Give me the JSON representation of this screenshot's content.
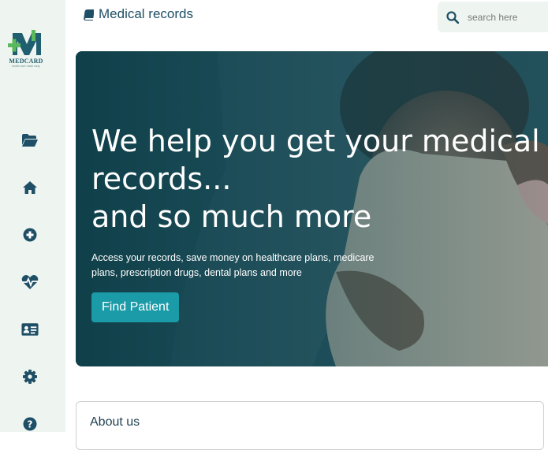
{
  "app": {
    "logo_text": "MEDCARD",
    "logo_tagline": "health care made easy",
    "brand_color": "#1f5f6f",
    "accent_color": "#1b9aa8",
    "logo_green": "#5cb85c"
  },
  "sidebar": {
    "items": [
      {
        "icon": "folder-open-icon"
      },
      {
        "icon": "home-icon"
      },
      {
        "icon": "plus-circle-icon"
      },
      {
        "icon": "heart-pulse-icon"
      },
      {
        "icon": "id-card-icon"
      },
      {
        "icon": "gear-icon"
      },
      {
        "icon": "question-circle-icon"
      }
    ]
  },
  "header": {
    "title": "Medical records",
    "title_icon": "book-icon"
  },
  "search": {
    "placeholder": "search here",
    "icon": "search-icon"
  },
  "hero": {
    "headline_line1": "We help you get your medical",
    "headline_line2": "records...",
    "headline_line3": "and so much more",
    "description": "Access your records, save money on healthcare plans, medicare plans, prescription drugs, dental plans and more",
    "button_label": "Find Patient"
  },
  "about": {
    "label": "About us"
  }
}
